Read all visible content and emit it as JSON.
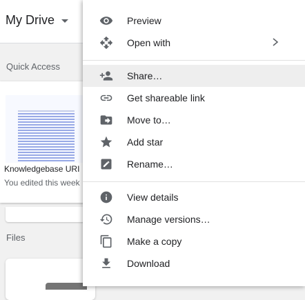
{
  "drive": {
    "title": "My Drive",
    "quick_access_label": "Quick Access",
    "files_label": "Files",
    "quick_access_item": {
      "name": "Knowledgebase URI",
      "subtitle": "You edited this week"
    }
  },
  "context_menu": {
    "groups": [
      [
        {
          "label": "Preview",
          "icon": "eye-icon"
        },
        {
          "label": "Open with",
          "icon": "open-with-icon",
          "submenu": true
        }
      ],
      [
        {
          "label": "Share…",
          "icon": "person-add-icon",
          "active": true
        },
        {
          "label": "Get shareable link",
          "icon": "link-icon"
        },
        {
          "label": "Move to…",
          "icon": "folder-move-icon"
        },
        {
          "label": "Add star",
          "icon": "star-icon"
        },
        {
          "label": "Rename…",
          "icon": "rename-icon"
        }
      ],
      [
        {
          "label": "View details",
          "icon": "info-icon"
        },
        {
          "label": "Manage versions…",
          "icon": "history-icon"
        },
        {
          "label": "Make a copy",
          "icon": "copy-icon"
        },
        {
          "label": "Download",
          "icon": "download-icon"
        }
      ]
    ]
  },
  "colors": {
    "menu_bg": "#ffffff",
    "active_item_bg": "#eeeeee",
    "icon": "#5f6368",
    "text": "#202124"
  }
}
